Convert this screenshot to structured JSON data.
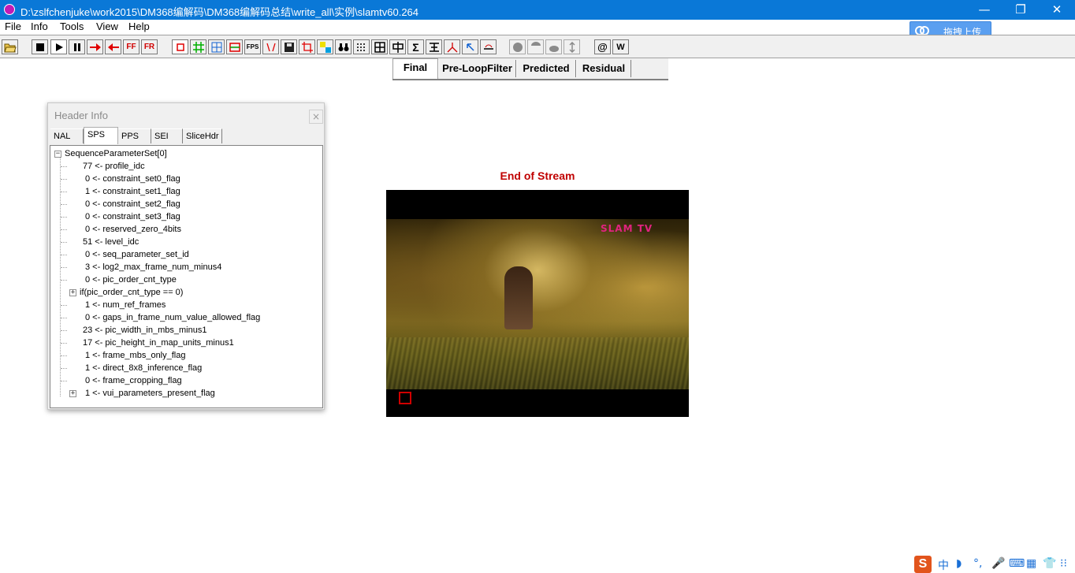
{
  "window": {
    "title": "D:\\zslfchenjuke\\work2015\\DM368编解码\\DM368编解码总结\\write_all\\实例\\slamtv60.264",
    "minimize": "—",
    "maximize": "❐",
    "close": "✕"
  },
  "menu": [
    "File",
    "Info",
    "Tools",
    "View",
    "Help"
  ],
  "baidu_upload": "拖拽上传",
  "toolbar": {
    "ff_label": "FF",
    "fr_label": "FR",
    "fps_label": "FPS",
    "at_label": "@",
    "w_label": "W"
  },
  "view_tabs": [
    "Final",
    "Pre-LoopFilter",
    "Predicted",
    "Residual"
  ],
  "header_info": {
    "title": "Header Info",
    "close": "×",
    "tabs": [
      "NAL",
      "SPS",
      "PPS",
      "SEI",
      "SliceHdr"
    ],
    "active_tab": "SPS",
    "root": "SequenceParameterSet[0]",
    "rows": [
      "77 <- profile_idc",
      "0 <- constraint_set0_flag",
      "1 <- constraint_set1_flag",
      "0 <- constraint_set2_flag",
      "0 <- constraint_set3_flag",
      "0 <- reserved_zero_4bits",
      "51 <- level_idc",
      "0 <- seq_parameter_set_id",
      "3 <- log2_max_frame_num_minus4",
      "0 <- pic_order_cnt_type",
      "if(pic_order_cnt_type == 0)",
      "1 <- num_ref_frames",
      "0 <- gaps_in_frame_num_value_allowed_flag",
      "23 <- pic_width_in_mbs_minus1",
      "17 <- pic_height_in_map_units_minus1",
      "1 <- frame_mbs_only_flag",
      "1 <- direct_8x8_inference_flag",
      "0 <- frame_cropping_flag",
      "1 <- vui_parameters_present_flag"
    ]
  },
  "video": {
    "status": "End of Stream",
    "logo": "SLAM TV"
  },
  "tray": {
    "ime_lang": "中",
    "moon": "◗",
    "dot": "°,",
    "mic": "🎤",
    "keyboard": "⌨",
    "grid": "▦",
    "shirt": "👕",
    "apps": "⁝⁝"
  }
}
